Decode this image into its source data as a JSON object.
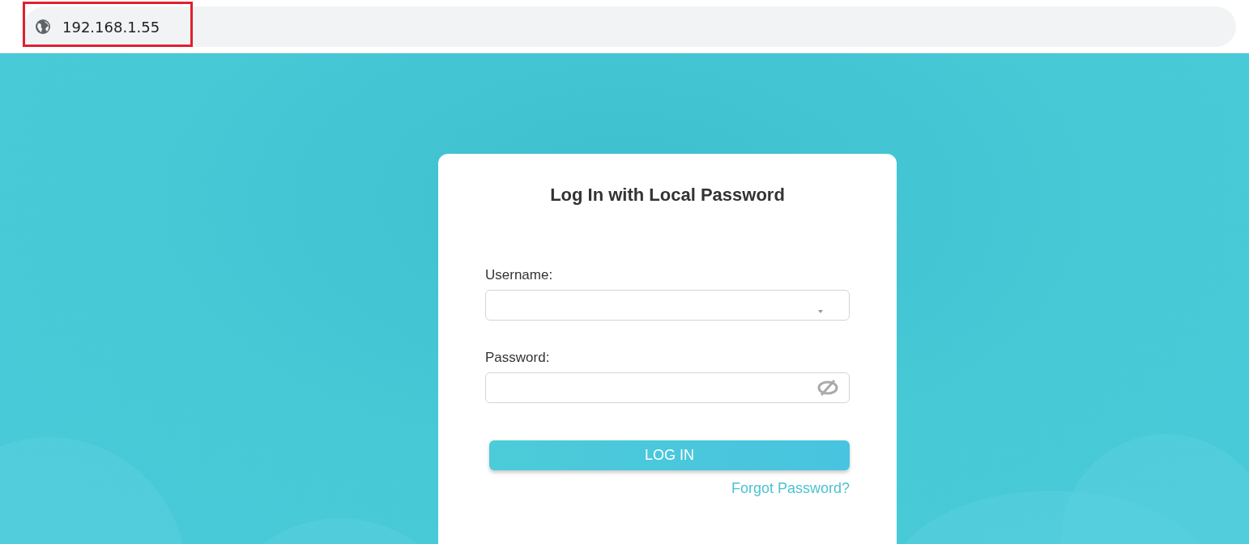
{
  "browser": {
    "address": "192.168.1.55",
    "address_highlighted": true
  },
  "login": {
    "title": "Log In with Local Password",
    "fields": [
      {
        "label": "Username:",
        "kind": "dropdown"
      },
      {
        "label": "Password:",
        "kind": "password"
      }
    ],
    "button": "LOG IN",
    "link": "Forgot Password?"
  }
}
